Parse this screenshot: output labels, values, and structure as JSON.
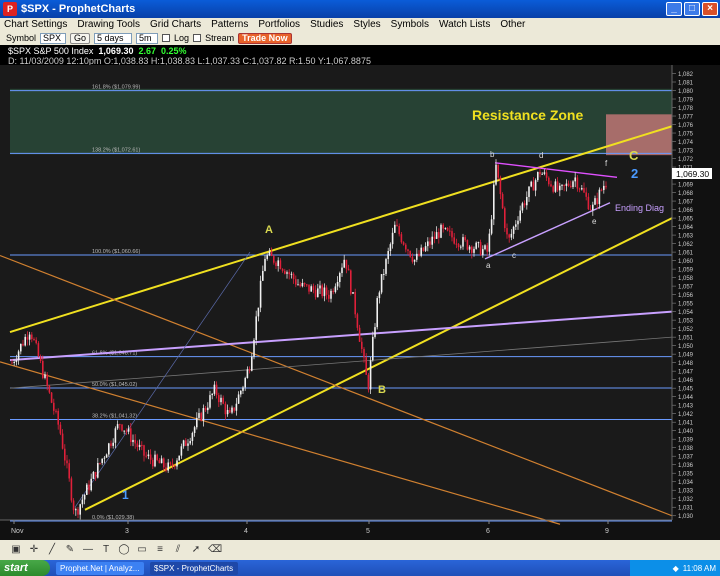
{
  "window": {
    "title": "$SPX - ProphetCharts"
  },
  "menu": [
    "Chart Settings",
    "Drawing Tools",
    "Grid Charts",
    "Patterns",
    "Portfolios",
    "Studies",
    "Styles",
    "Symbols",
    "Watch Lists",
    "Other"
  ],
  "toolbar": {
    "symbol_label": "Symbol",
    "symbol_value": "SPX",
    "go_label": "Go",
    "range_value": "5 days",
    "interval_value": "5m",
    "log_label": "Log",
    "stream_label": "Stream",
    "trade_label": "Trade Now"
  },
  "quote": {
    "name": "$SPX S&P 500 Index",
    "last": "1,069.30",
    "change": "2.67",
    "pct": "0.25%",
    "detail": "D: 11/03/2009  12:10pm O:1,038.83 H:1,038.83 L:1,037.33 C:1,037.82 R:1.50 Y:1,067.8875"
  },
  "chart_data": {
    "type": "candlestick",
    "x_labels": [
      "Nov",
      "3",
      "4",
      "5",
      "6",
      "9"
    ],
    "y_min": 1029.5,
    "y_max": 1083,
    "y_ticks": [
      1030,
      1031,
      1032,
      1033,
      1034,
      1035,
      1036,
      1037,
      1038,
      1039,
      1040,
      1041,
      1042,
      1043,
      1044,
      1045,
      1046,
      1047,
      1048,
      1049,
      1050,
      1051,
      1052,
      1053,
      1054,
      1055,
      1056,
      1057,
      1058,
      1059,
      1060,
      1061,
      1062,
      1063,
      1064,
      1065,
      1066,
      1067,
      1068,
      1069,
      1070,
      1071,
      1072,
      1073,
      1074,
      1075,
      1076,
      1077,
      1078,
      1079,
      1080,
      1081,
      1082
    ],
    "last_price": "1,069.30",
    "fib_levels": [
      {
        "label": "161.8%  ($1,079.99)",
        "value": 1079.99
      },
      {
        "label": "138.2%  ($1,072.61)",
        "value": 1072.61
      },
      {
        "label": "100.0%  ($1,060.66)",
        "value": 1060.66
      },
      {
        "label": "61.8%  ($1,048.71)",
        "value": 1048.71
      },
      {
        "label": "50.0%  ($1,045.02)",
        "value": 1045.02
      },
      {
        "label": "38.2%  ($1,041.32)",
        "value": 1041.32
      },
      {
        "label": "0.0%  ($1,029.38)",
        "value": 1029.38
      }
    ],
    "annotations": {
      "resistance": "Resistance Zone",
      "wave_a": "A",
      "wave_b": "B",
      "wave_c": "C",
      "wave_1": "1",
      "wave_2": "2",
      "ending_diag": "Ending Diag",
      "sub_a": "a",
      "sub_b": "b",
      "sub_c": "c",
      "sub_d": "d",
      "sub_e": "e",
      "sub_f": "f"
    },
    "colors": {
      "background": "#1a1a1a",
      "fib": "#6a9aff",
      "channel": "#f0e020",
      "down_channel": "#d08030",
      "diag": "#c8a0ff",
      "zone": "#2a4a3a"
    }
  },
  "taskbar": {
    "start_label": "start",
    "tasks": [
      "Prophet.Net | Analyz...",
      "$SPX - ProphetCharts"
    ],
    "clock": "11:08 AM"
  }
}
